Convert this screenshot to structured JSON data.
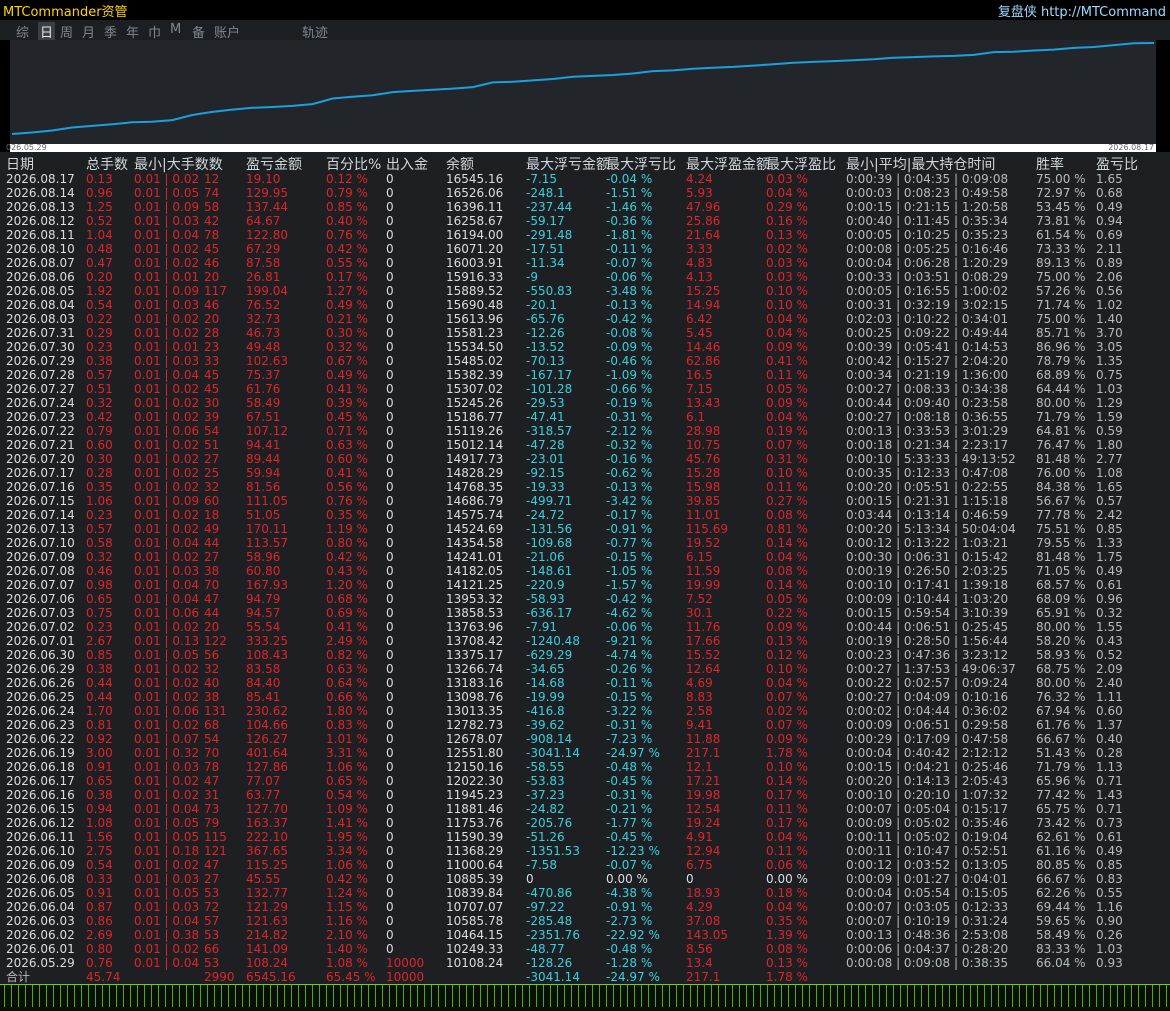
{
  "app": {
    "title": "MTCommander资管",
    "brand": "复盘侠 http://MTCommand"
  },
  "tabs": [
    {
      "label": "综",
      "active": false
    },
    {
      "label": "日",
      "active": true
    },
    {
      "label": "周",
      "active": false
    },
    {
      "label": "月",
      "active": false
    },
    {
      "label": "季",
      "active": false
    },
    {
      "label": "年",
      "active": false
    },
    {
      "label": "巾",
      "active": false
    },
    {
      "label": "M",
      "active": false
    },
    {
      "label": "备",
      "active": false
    },
    {
      "label": "账户",
      "active": false
    },
    {
      "label": "轨迹",
      "active": false
    }
  ],
  "curve": {
    "start_label": "026.05.29",
    "end_label": "2026.08.17",
    "line_color": "#1aa0e0"
  },
  "table": {
    "headers": [
      "日期",
      "总手数",
      "最小|大手数数",
      "盈亏金额",
      "百分比%",
      "出入金",
      "余额",
      "最大浮亏金额",
      "最大浮亏比",
      "最大浮盈金额",
      "最大浮盈比",
      "最小|平均|最大持仓时间",
      "胜率",
      "盈亏比"
    ],
    "rows": [
      [
        "2026.08.17",
        "0.13",
        "0.01 | 0.02",
        "12",
        "19.10",
        "0.12 %",
        "0",
        "16545.16",
        "-7.15",
        "-0.04 %",
        "4.24",
        "0.03 %",
        "0:00:39 | 0:04:35 | 0:09:08",
        "75.00 %",
        "1.65"
      ],
      [
        "2026.08.14",
        "0.96",
        "0.01 | 0.05",
        "74",
        "129.95",
        "0.79 %",
        "0",
        "16526.06",
        "-248.1",
        "-1.51 %",
        "5.93",
        "0.04 %",
        "0:00:03 | 0:08:23 | 0:49:58",
        "72.97 %",
        "0.68"
      ],
      [
        "2026.08.13",
        "1.25",
        "0.01 | 0.09",
        "58",
        "137.44",
        "0.85 %",
        "0",
        "16396.11",
        "-237.44",
        "-1.46 %",
        "47.96",
        "0.29 %",
        "0:00:15 | 0:21:15 | 1:20:58",
        "53.45 %",
        "0.49"
      ],
      [
        "2026.08.12",
        "0.52",
        "0.01 | 0.03",
        "42",
        "64.67",
        "0.40 %",
        "0",
        "16258.67",
        "-59.17",
        "-0.36 %",
        "25.86",
        "0.16 %",
        "0:00:40 | 0:11:45 | 0:35:34",
        "73.81 %",
        "0.94"
      ],
      [
        "2026.08.11",
        "1.04",
        "0.01 | 0.04",
        "78",
        "122.80",
        "0.76 %",
        "0",
        "16194.00",
        "-291.48",
        "-1.81 %",
        "21.64",
        "0.13 %",
        "0:00:05 | 0:10:25 | 0:35:23",
        "61.54 %",
        "0.69"
      ],
      [
        "2026.08.10",
        "0.48",
        "0.01 | 0.02",
        "45",
        "67.29",
        "0.42 %",
        "0",
        "16071.20",
        "-17.51",
        "-0.11 %",
        "3.33",
        "0.02 %",
        "0:00:08 | 0:05:25 | 0:16:46",
        "73.33 %",
        "2.11"
      ],
      [
        "2026.08.07",
        "0.47",
        "0.01 | 0.02",
        "46",
        "87.58",
        "0.55 %",
        "0",
        "16003.91",
        "-11.34",
        "-0.07 %",
        "4.83",
        "0.03 %",
        "0:00:04 | 0:06:28 | 1:20:29",
        "89.13 %",
        "0.89"
      ],
      [
        "2026.08.06",
        "0.20",
        "0.01 | 0.01",
        "20",
        "26.81",
        "0.17 %",
        "0",
        "15916.33",
        "-9",
        "-0.06 %",
        "4.13",
        "0.03 %",
        "0:00:33 | 0:03:51 | 0:08:29",
        "75.00 %",
        "2.06"
      ],
      [
        "2026.08.05",
        "1.92",
        "0.01 | 0.09",
        "117",
        "199.04",
        "1.27 %",
        "0",
        "15889.52",
        "-550.83",
        "-3.48 %",
        "15.25",
        "0.10 %",
        "0:00:05 | 0:16:55 | 1:00:02",
        "57.26 %",
        "0.56"
      ],
      [
        "2026.08.04",
        "0.54",
        "0.01 | 0.03",
        "46",
        "76.52",
        "0.49 %",
        "0",
        "15690.48",
        "-20.1",
        "-0.13 %",
        "14.94",
        "0.10 %",
        "0:00:31 | 0:32:19 | 3:02:15",
        "71.74 %",
        "1.02"
      ],
      [
        "2026.08.03",
        "0.22",
        "0.01 | 0.02",
        "20",
        "32.73",
        "0.21 %",
        "0",
        "15613.96",
        "-65.76",
        "-0.42 %",
        "6.42",
        "0.04 %",
        "0:02:03 | 0:10:22 | 0:34:01",
        "75.00 %",
        "1.40"
      ],
      [
        "2026.07.31",
        "0.29",
        "0.01 | 0.02",
        "28",
        "46.73",
        "0.30 %",
        "0",
        "15581.23",
        "-12.26",
        "-0.08 %",
        "5.45",
        "0.04 %",
        "0:00:25 | 0:09:22 | 0:49:44",
        "85.71 %",
        "3.70"
      ],
      [
        "2026.07.30",
        "0.23",
        "0.01 | 0.01",
        "23",
        "49.48",
        "0.32 %",
        "0",
        "15534.50",
        "-13.52",
        "-0.09 %",
        "14.46",
        "0.09 %",
        "0:00:39 | 0:05:41 | 0:14:53",
        "86.96 %",
        "3.05"
      ],
      [
        "2026.07.29",
        "0.38",
        "0.01 | 0.03",
        "33",
        "102.63",
        "0.67 %",
        "0",
        "15485.02",
        "-70.13",
        "-0.46 %",
        "62.86",
        "0.41 %",
        "0:00:42 | 0:15:27 | 2:04:20",
        "78.79 %",
        "1.35"
      ],
      [
        "2026.07.28",
        "0.57",
        "0.01 | 0.04",
        "45",
        "75.37",
        "0.49 %",
        "0",
        "15382.39",
        "-167.17",
        "-1.09 %",
        "16.5",
        "0.11 %",
        "0:00:34 | 0:21:19 | 1:36:00",
        "68.89 %",
        "0.75"
      ],
      [
        "2026.07.27",
        "0.51",
        "0.01 | 0.02",
        "45",
        "61.76",
        "0.41 %",
        "0",
        "15307.02",
        "-101.28",
        "-0.66 %",
        "7.15",
        "0.05 %",
        "0:00:27 | 0:08:33 | 0:34:38",
        "64.44 %",
        "1.03"
      ],
      [
        "2026.07.24",
        "0.32",
        "0.01 | 0.02",
        "30",
        "58.49",
        "0.39 %",
        "0",
        "15245.26",
        "-29.53",
        "-0.19 %",
        "13.43",
        "0.09 %",
        "0:00:44 | 0:09:40 | 0:23:58",
        "80.00 %",
        "1.29"
      ],
      [
        "2026.07.23",
        "0.42",
        "0.01 | 0.02",
        "39",
        "67.51",
        "0.45 %",
        "0",
        "15186.77",
        "-47.41",
        "-0.31 %",
        "6.1",
        "0.04 %",
        "0:00:27 | 0:08:18 | 0:36:55",
        "71.79 %",
        "1.59"
      ],
      [
        "2026.07.22",
        "0.79",
        "0.01 | 0.06",
        "54",
        "107.12",
        "0.71 %",
        "0",
        "15119.26",
        "-318.57",
        "-2.12 %",
        "28.98",
        "0.19 %",
        "0:00:13 | 0:33:53 | 3:01:29",
        "64.81 %",
        "0.59"
      ],
      [
        "2026.07.21",
        "0.60",
        "0.01 | 0.02",
        "51",
        "94.41",
        "0.63 %",
        "0",
        "15012.14",
        "-47.28",
        "-0.32 %",
        "10.75",
        "0.07 %",
        "0:00:18 | 0:21:34 | 2:23:17",
        "76.47 %",
        "1.80"
      ],
      [
        "2026.07.20",
        "0.30",
        "0.01 | 0.02",
        "27",
        "89.44",
        "0.60 %",
        "0",
        "14917.73",
        "-23.01",
        "-0.16 %",
        "45.76",
        "0.31 %",
        "0:00:10 | 5:33:33 | 49:13:52",
        "81.48 %",
        "2.77"
      ],
      [
        "2026.07.17",
        "0.28",
        "0.01 | 0.02",
        "25",
        "59.94",
        "0.41 %",
        "0",
        "14828.29",
        "-92.15",
        "-0.62 %",
        "15.28",
        "0.10 %",
        "0:00:35 | 0:12:33 | 0:47:08",
        "76.00 %",
        "1.08"
      ],
      [
        "2026.07.16",
        "0.35",
        "0.01 | 0.02",
        "32",
        "81.56",
        "0.56 %",
        "0",
        "14768.35",
        "-19.33",
        "-0.13 %",
        "15.98",
        "0.11 %",
        "0:00:20 | 0:05:51 | 0:22:55",
        "84.38 %",
        "1.65"
      ],
      [
        "2026.07.15",
        "1.06",
        "0.01 | 0.09",
        "60",
        "111.05",
        "0.76 %",
        "0",
        "14686.79",
        "-499.71",
        "-3.42 %",
        "39.85",
        "0.27 %",
        "0:00:15 | 0:21:31 | 1:15:18",
        "56.67 %",
        "0.57"
      ],
      [
        "2026.07.14",
        "0.23",
        "0.01 | 0.02",
        "18",
        "51.05",
        "0.35 %",
        "0",
        "14575.74",
        "-24.72",
        "-0.17 %",
        "11.01",
        "0.08 %",
        "0:03:44 | 0:13:14 | 0:46:59",
        "77.78 %",
        "2.42"
      ],
      [
        "2026.07.13",
        "0.57",
        "0.01 | 0.02",
        "49",
        "170.11",
        "1.19 %",
        "0",
        "14524.69",
        "-131.56",
        "-0.91 %",
        "115.69",
        "0.81 %",
        "0:00:20 | 5:13:34 | 50:04:04",
        "75.51 %",
        "0.85"
      ],
      [
        "2026.07.10",
        "0.58",
        "0.01 | 0.04",
        "44",
        "113.57",
        "0.80 %",
        "0",
        "14354.58",
        "-109.68",
        "-0.77 %",
        "19.52",
        "0.14 %",
        "0:00:12 | 0:13:22 | 1:03:21",
        "79.55 %",
        "1.33"
      ],
      [
        "2026.07.09",
        "0.32",
        "0.01 | 0.02",
        "27",
        "58.96",
        "0.42 %",
        "0",
        "14241.01",
        "-21.06",
        "-0.15 %",
        "6.15",
        "0.04 %",
        "0:00:30 | 0:06:31 | 0:15:42",
        "81.48 %",
        "1.75"
      ],
      [
        "2026.07.08",
        "0.46",
        "0.01 | 0.03",
        "38",
        "60.80",
        "0.43 %",
        "0",
        "14182.05",
        "-148.61",
        "-1.05 %",
        "11.59",
        "0.08 %",
        "0:00:19 | 0:26:50 | 2:03:25",
        "71.05 %",
        "0.49"
      ],
      [
        "2026.07.07",
        "0.98",
        "0.01 | 0.04",
        "70",
        "167.93",
        "1.20 %",
        "0",
        "14121.25",
        "-220.9",
        "-1.57 %",
        "19.99",
        "0.14 %",
        "0:00:10 | 0:17:41 | 1:39:18",
        "68.57 %",
        "0.61"
      ],
      [
        "2026.07.06",
        "0.65",
        "0.01 | 0.04",
        "47",
        "94.79",
        "0.68 %",
        "0",
        "13953.32",
        "-58.93",
        "-0.42 %",
        "7.52",
        "0.05 %",
        "0:00:09 | 0:10:44 | 1:03:20",
        "68.09 %",
        "0.96"
      ],
      [
        "2026.07.03",
        "0.75",
        "0.01 | 0.06",
        "44",
        "94.57",
        "0.69 %",
        "0",
        "13858.53",
        "-636.17",
        "-4.62 %",
        "30.1",
        "0.22 %",
        "0:00:15 | 0:59:54 | 3:10:39",
        "65.91 %",
        "0.32"
      ],
      [
        "2026.07.02",
        "0.23",
        "0.01 | 0.02",
        "20",
        "55.54",
        "0.41 %",
        "0",
        "13763.96",
        "-7.91",
        "-0.06 %",
        "11.76",
        "0.09 %",
        "0:00:44 | 0:06:51 | 0:25:45",
        "80.00 %",
        "1.55"
      ],
      [
        "2026.07.01",
        "2.67",
        "0.01 | 0.13",
        "122",
        "333.25",
        "2.49 %",
        "0",
        "13708.42",
        "-1240.48",
        "-9.21 %",
        "17.66",
        "0.13 %",
        "0:00:19 | 0:28:50 | 1:56:44",
        "58.20 %",
        "0.43"
      ],
      [
        "2026.06.30",
        "0.85",
        "0.01 | 0.05",
        "56",
        "108.43",
        "0.82 %",
        "0",
        "13375.17",
        "-629.29",
        "-4.74 %",
        "15.52",
        "0.12 %",
        "0:00:23 | 0:47:36 | 3:23:12",
        "58.93 %",
        "0.52"
      ],
      [
        "2026.06.29",
        "0.38",
        "0.01 | 0.02",
        "32",
        "83.58",
        "0.63 %",
        "0",
        "13266.74",
        "-34.65",
        "-0.26 %",
        "12.64",
        "0.10 %",
        "0:00:27 | 1:37:53 | 49:06:37",
        "68.75 %",
        "2.09"
      ],
      [
        "2026.06.26",
        "0.44",
        "0.01 | 0.02",
        "40",
        "84.40",
        "0.64 %",
        "0",
        "13183.16",
        "-14.68",
        "-0.11 %",
        "4.69",
        "0.04 %",
        "0:00:22 | 0:02:57 | 0:09:24",
        "80.00 %",
        "2.40"
      ],
      [
        "2026.06.25",
        "0.44",
        "0.01 | 0.02",
        "38",
        "85.41",
        "0.66 %",
        "0",
        "13098.76",
        "-19.99",
        "-0.15 %",
        "8.83",
        "0.07 %",
        "0:00:27 | 0:04:09 | 0:10:16",
        "76.32 %",
        "1.11"
      ],
      [
        "2026.06.24",
        "1.70",
        "0.01 | 0.06",
        "131",
        "230.62",
        "1.80 %",
        "0",
        "13013.35",
        "-416.8",
        "-3.22 %",
        "2.58",
        "0.02 %",
        "0:00:02 | 0:04:44 | 0:36:02",
        "67.94 %",
        "0.60"
      ],
      [
        "2026.06.23",
        "0.81",
        "0.01 | 0.02",
        "68",
        "104.66",
        "0.83 %",
        "0",
        "12782.73",
        "-39.62",
        "-0.31 %",
        "9.41",
        "0.07 %",
        "0:00:09 | 0:06:51 | 0:29:58",
        "61.76 %",
        "1.37"
      ],
      [
        "2026.06.22",
        "0.92",
        "0.01 | 0.07",
        "54",
        "126.27",
        "1.01 %",
        "0",
        "12678.07",
        "-908.14",
        "-7.23 %",
        "11.88",
        "0.09 %",
        "0:00:29 | 0:17:09 | 0:47:58",
        "66.67 %",
        "0.40"
      ],
      [
        "2026.06.19",
        "3.00",
        "0.01 | 0.32",
        "70",
        "401.64",
        "3.31 %",
        "0",
        "12551.80",
        "-3041.14",
        "-24.97 %",
        "217.1",
        "1.78 %",
        "0:00:04 | 0:40:42 | 2:12:12",
        "51.43 %",
        "0.28"
      ],
      [
        "2026.06.18",
        "0.91",
        "0.01 | 0.03",
        "78",
        "127.86",
        "1.06 %",
        "0",
        "12150.16",
        "-58.55",
        "-0.48 %",
        "12.1",
        "0.10 %",
        "0:00:15 | 0:04:21 | 0:25:46",
        "71.79 %",
        "1.13"
      ],
      [
        "2026.06.17",
        "0.65",
        "0.01 | 0.02",
        "47",
        "77.07",
        "0.65 %",
        "0",
        "12022.30",
        "-53.83",
        "-0.45 %",
        "17.21",
        "0.14 %",
        "0:00:20 | 0:14:13 | 2:05:43",
        "65.96 %",
        "0.71"
      ],
      [
        "2026.06.16",
        "0.38",
        "0.01 | 0.02",
        "31",
        "63.77",
        "0.54 %",
        "0",
        "11945.23",
        "-37.23",
        "-0.31 %",
        "19.98",
        "0.17 %",
        "0:00:10 | 0:20:10 | 1:07:32",
        "77.42 %",
        "1.43"
      ],
      [
        "2026.06.15",
        "0.94",
        "0.01 | 0.04",
        "73",
        "127.70",
        "1.09 %",
        "0",
        "11881.46",
        "-24.82",
        "-0.21 %",
        "12.54",
        "0.11 %",
        "0:00:07 | 0:05:04 | 0:15:17",
        "65.75 %",
        "0.71"
      ],
      [
        "2026.06.12",
        "1.08",
        "0.01 | 0.05",
        "79",
        "163.37",
        "1.41 %",
        "0",
        "11753.76",
        "-205.76",
        "-1.77 %",
        "19.24",
        "0.17 %",
        "0:00:09 | 0:05:02 | 0:35:46",
        "73.42 %",
        "0.73"
      ],
      [
        "2026.06.11",
        "1.56",
        "0.01 | 0.05",
        "115",
        "222.10",
        "1.95 %",
        "0",
        "11590.39",
        "-51.26",
        "-0.45 %",
        "4.91",
        "0.04 %",
        "0:00:11 | 0:05:02 | 0:19:04",
        "62.61 %",
        "0.61"
      ],
      [
        "2026.06.10",
        "2.75",
        "0.01 | 0.18",
        "121",
        "367.65",
        "3.34 %",
        "0",
        "11368.29",
        "-1351.53",
        "-12.23 %",
        "12.94",
        "0.11 %",
        "0:00:11 | 0:10:47 | 0:52:51",
        "61.16 %",
        "0.49"
      ],
      [
        "2026.06.09",
        "0.54",
        "0.01 | 0.02",
        "47",
        "115.25",
        "1.06 %",
        "0",
        "11000.64",
        "-7.58",
        "-0.07 %",
        "6.75",
        "0.06 %",
        "0:00:12 | 0:03:52 | 0:13:05",
        "80.85 %",
        "0.85"
      ],
      [
        "2026.06.08",
        "0.33",
        "0.01 | 0.03",
        "27",
        "45.55",
        "0.42 %",
        "0",
        "10885.39",
        "0",
        "0.00 %",
        "0",
        "0.00 %",
        "0:00:09 | 0:01:27 | 0:04:01",
        "66.67 %",
        "0.83"
      ],
      [
        "2026.06.05",
        "0.91",
        "0.01 | 0.05",
        "53",
        "132.77",
        "1.24 %",
        "0",
        "10839.84",
        "-470.86",
        "-4.38 %",
        "18.93",
        "0.18 %",
        "0:00:04 | 0:05:54 | 0:15:05",
        "62.26 %",
        "0.55"
      ],
      [
        "2026.06.04",
        "0.87",
        "0.01 | 0.03",
        "72",
        "121.29",
        "1.15 %",
        "0",
        "10707.07",
        "-97.22",
        "-0.91 %",
        "4.29",
        "0.04 %",
        "0:00:07 | 0:03:05 | 0:12:33",
        "69.44 %",
        "1.16"
      ],
      [
        "2026.06.03",
        "0.86",
        "0.01 | 0.04",
        "57",
        "121.63",
        "1.16 %",
        "0",
        "10585.78",
        "-285.48",
        "-2.73 %",
        "37.08",
        "0.35 %",
        "0:00:07 | 0:10:19 | 0:31:24",
        "59.65 %",
        "0.90"
      ],
      [
        "2026.06.02",
        "2.69",
        "0.01 | 0.38",
        "53",
        "214.82",
        "2.10 %",
        "0",
        "10464.15",
        "-2351.76",
        "-22.92 %",
        "143.05",
        "1.39 %",
        "0:00:13 | 0:48:36 | 2:53:08",
        "58.49 %",
        "0.26"
      ],
      [
        "2026.06.01",
        "0.80",
        "0.01 | 0.02",
        "66",
        "141.09",
        "1.40 %",
        "0",
        "10249.33",
        "-48.77",
        "-0.48 %",
        "8.56",
        "0.08 %",
        "0:00:06 | 0:04:37 | 0:28:20",
        "83.33 %",
        "1.03"
      ],
      [
        "2026.05.29",
        "0.76",
        "0.01 | 0.04",
        "53",
        "108.24",
        "1.08 %",
        "10000",
        "10108.24",
        "-128.26",
        "-1.28 %",
        "13.4",
        "0.13 %",
        "0:00:08 | 0:09:08 | 0:38:35",
        "66.04 %",
        "0.93"
      ]
    ],
    "total": {
      "label": "合计",
      "lots": "45.74",
      "trades": "2990",
      "pnl": "6545.16",
      "pct": "65.45 %",
      "deposit": "10000",
      "max_loss": "-3041.14",
      "max_loss_pct": "-24.97 %",
      "max_profit": "217.1",
      "max_profit_pct": "1.78 %"
    }
  }
}
